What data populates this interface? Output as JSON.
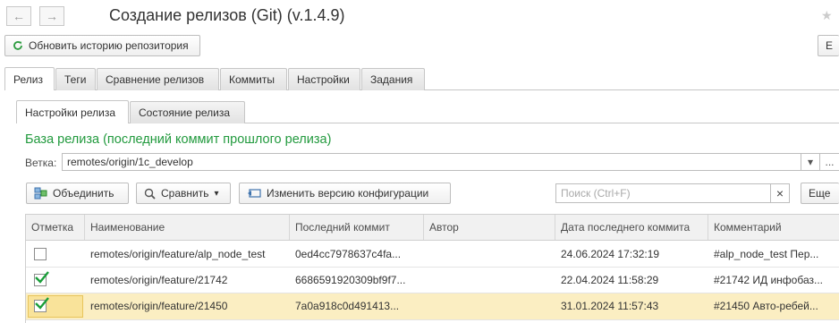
{
  "window": {
    "title": "Создание релизов (Git) (v.1.4.9)"
  },
  "nav": {
    "back_glyph": "←",
    "forward_glyph": "→",
    "star_glyph": "★"
  },
  "toolbar": {
    "refresh_label": "Обновить историю репозитория",
    "right_cut_label": "Е"
  },
  "tabs": [
    {
      "label": "Релиз",
      "active": true
    },
    {
      "label": "Теги"
    },
    {
      "label": "Сравнение релизов"
    },
    {
      "label": "Коммиты"
    },
    {
      "label": "Настройки"
    },
    {
      "label": "Задания"
    }
  ],
  "subtabs": [
    {
      "label": "Настройки релиза",
      "active": true
    },
    {
      "label": "Состояние релиза"
    }
  ],
  "section": {
    "title": "База релиза (последний коммит прошлого релиза)"
  },
  "branch": {
    "label": "Ветка:",
    "value": "remotes/origin/1c_develop",
    "dropdown_glyph": "▾",
    "more_glyph": "..."
  },
  "actions": {
    "merge_label": "Объединить",
    "compare_label": "Сравнить",
    "compare_arrow": "▾",
    "change_version_label": "Изменить версию конфигурации",
    "search_placeholder": "Поиск (Ctrl+F)",
    "search_clear": "×",
    "more_label": "Еще"
  },
  "colors": {
    "section_title": "#229a3e",
    "check": "#1a9e3a",
    "selected_row": "#fbeec2"
  },
  "table": {
    "columns": [
      "Отметка",
      "Наименование",
      "Последний коммит",
      "Автор",
      "Дата последнего коммита",
      "Комментарий"
    ],
    "rows": [
      {
        "checked": false,
        "name": "remotes/origin/feature/alp_node_test",
        "commit": "0ed4cc7978637c4fa...",
        "author": "",
        "date": "24.06.2024 17:32:19",
        "comment": "#alp_node_test Пер..."
      },
      {
        "checked": true,
        "name": "remotes/origin/feature/21742",
        "commit": "6686591920309bf9f7...",
        "author": "",
        "date": "22.04.2024 11:58:29",
        "comment": "#21742 ИД инфобаз..."
      },
      {
        "checked": true,
        "name": "remotes/origin/feature/21450",
        "commit": "7a0a918c0d491413...",
        "author": "",
        "date": "31.01.2024 11:57:43",
        "comment": "#21450 Авто-ребей...",
        "selected": true
      }
    ]
  }
}
